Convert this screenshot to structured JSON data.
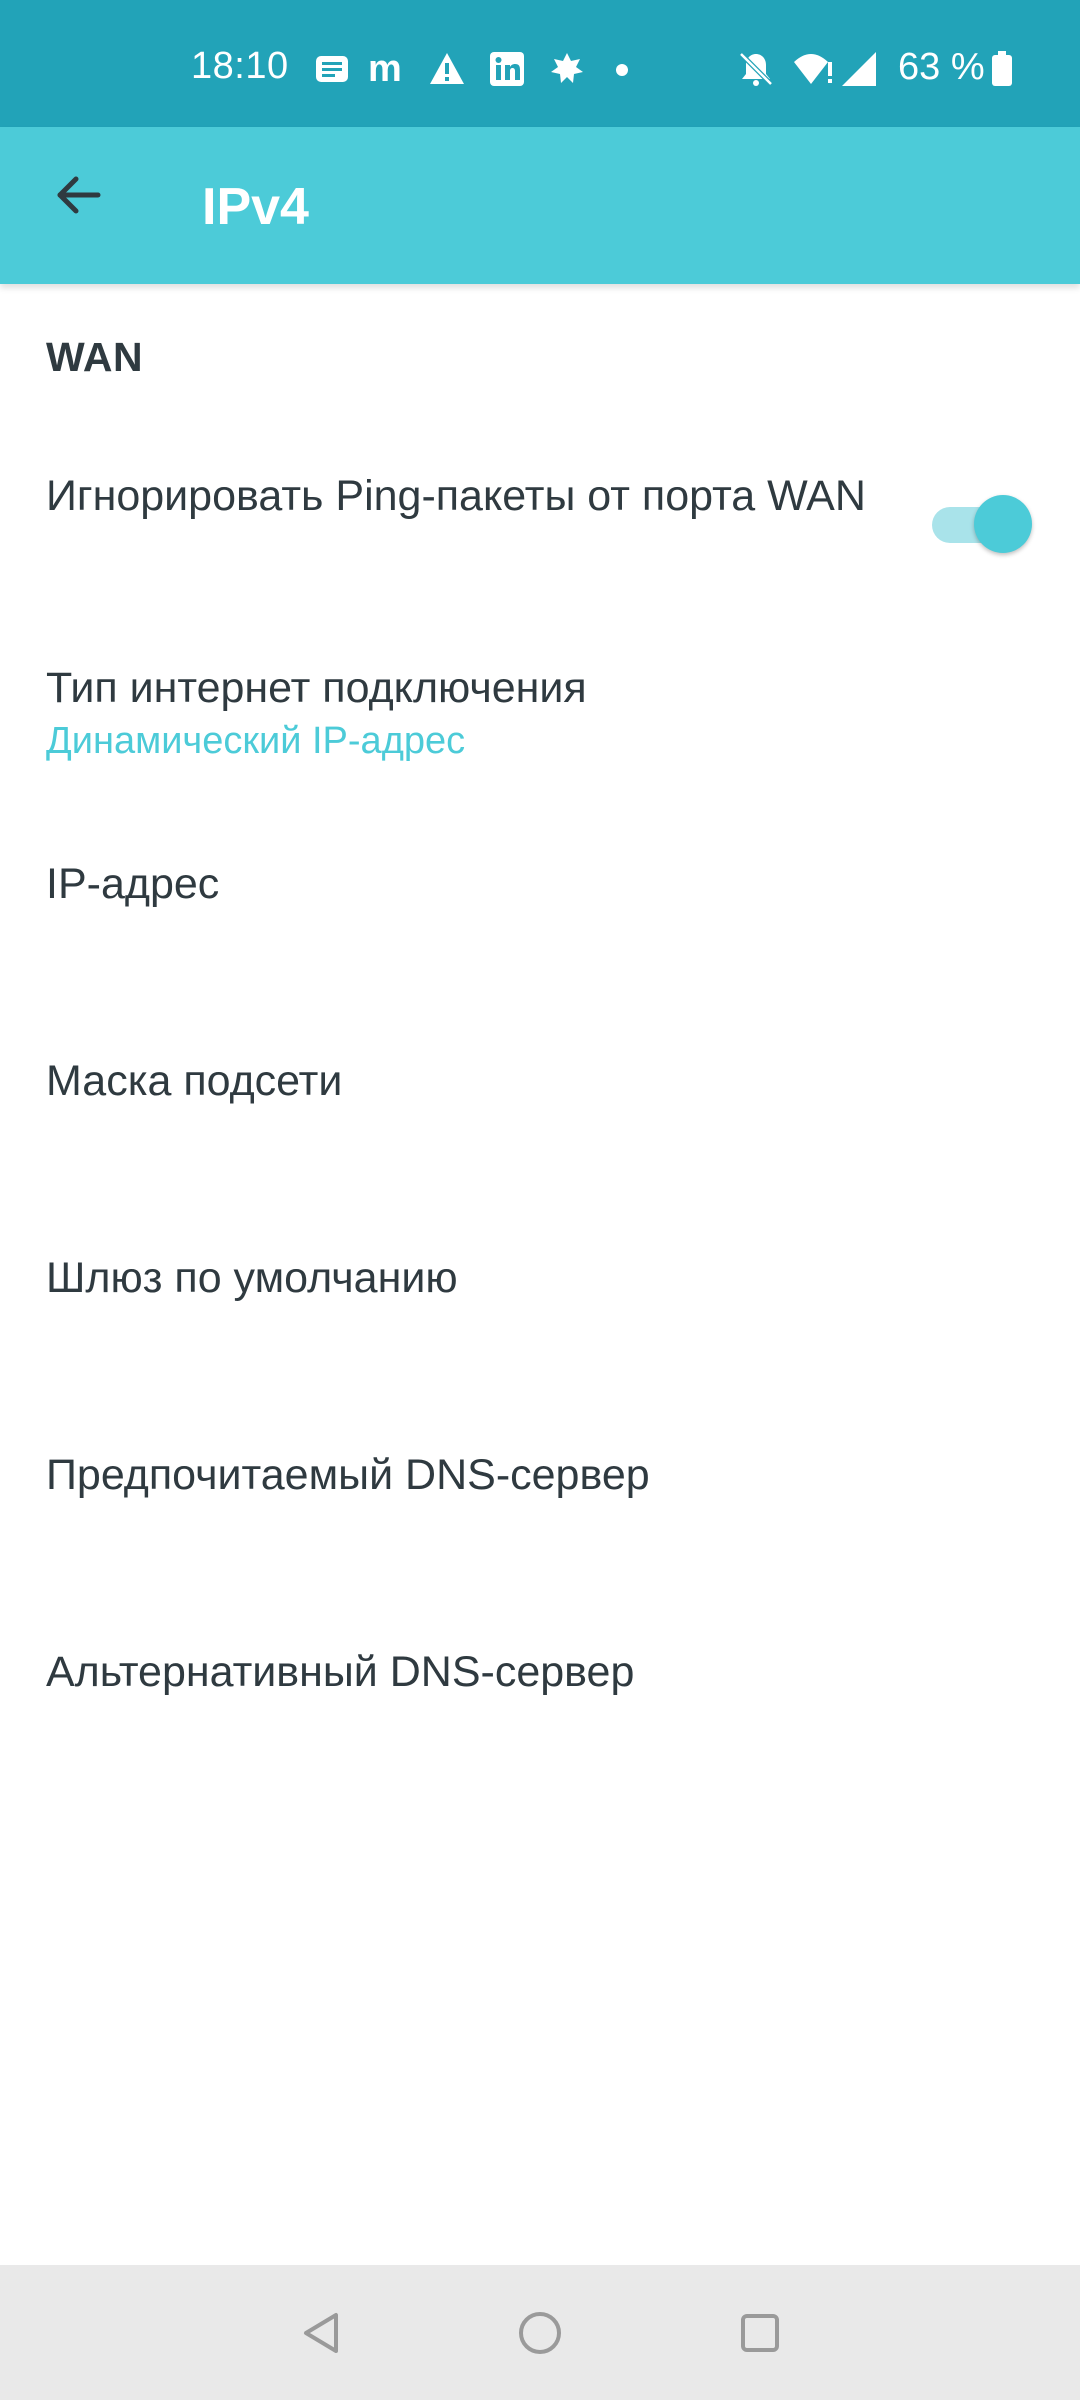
{
  "status_bar": {
    "time": "18:10",
    "battery_text": "63 %",
    "icons": [
      "message-icon",
      "m-app-icon",
      "warning-icon",
      "linkedin-icon",
      "leaf-app-icon",
      "dot-icon",
      "muted-bell-icon",
      "wifi-icon",
      "signal-icon",
      "battery-icon"
    ]
  },
  "app_bar": {
    "title": "IPv4",
    "back_icon": "arrow-back-icon"
  },
  "section": {
    "header": "WAN"
  },
  "rows": [
    {
      "title": "Игнорировать Ping-пакеты от порта WAN",
      "toggle_on": true
    },
    {
      "title": "Тип интернет подключения",
      "subtitle": "Динамический IP-адрес"
    },
    {
      "title": "IP-адрес"
    },
    {
      "title": "Маска подсети"
    },
    {
      "title": "Шлюз по умолчанию"
    },
    {
      "title": "Предпочитаемый DNS-сервер"
    },
    {
      "title": "Альтернативный DNS-сервер"
    }
  ],
  "nav_bar": {
    "icons": [
      "back-triangle-icon",
      "home-circle-icon",
      "recents-square-icon"
    ]
  },
  "colors": {
    "status_bar": "#22a3b8",
    "app_bar": "#4ccbd8",
    "accent": "#4ccbd8",
    "text": "#2f3a40",
    "nav_bar": "#e9e9e9"
  }
}
